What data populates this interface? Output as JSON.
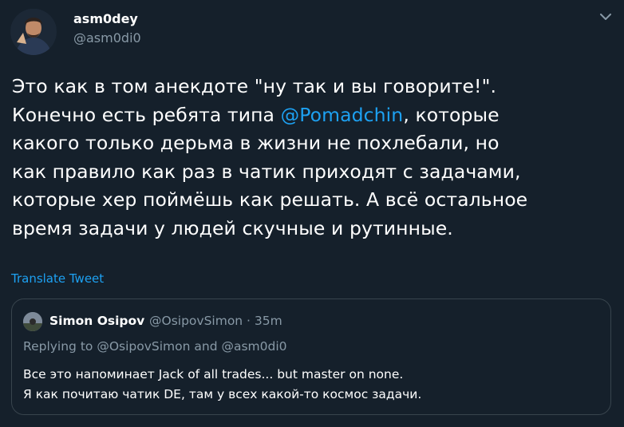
{
  "theme": {
    "background": "#15202b",
    "accent": "#1da1f2",
    "muted": "#8899a6",
    "border": "#38444d"
  },
  "tweet": {
    "author_name": "asm0dey",
    "author_handle": "@asm0di0",
    "text_before": "Это как в том анекдоте \"ну так и вы говорите!\".\nКонечно есть ребята типа ",
    "mention": "@Pomadchin",
    "text_after": ", которые\nкакого только дерьма в жизни не похлебали, но\nкак правило как раз в чатик приходят с задачами,\nкоторые хер поймёшь как решать. А всё остальное\nвремя задачи у людей скучные и рутинные.",
    "translate_label": "Translate Tweet"
  },
  "quote": {
    "author_name": "Simon Osipov",
    "author_handle": "@OsipovSimon · 35m",
    "reply_prefix": "Replying to ",
    "reply_mention_1": "@OsipovSimon",
    "reply_and": " and ",
    "reply_mention_2": "@asm0di0",
    "text": "Все это напоминает Jack of all trades... but master on none.\nЯ как почитаю чатик DE, там у всех какой-то космос задачи."
  },
  "icons": {
    "menu": "chevron-down-icon"
  }
}
